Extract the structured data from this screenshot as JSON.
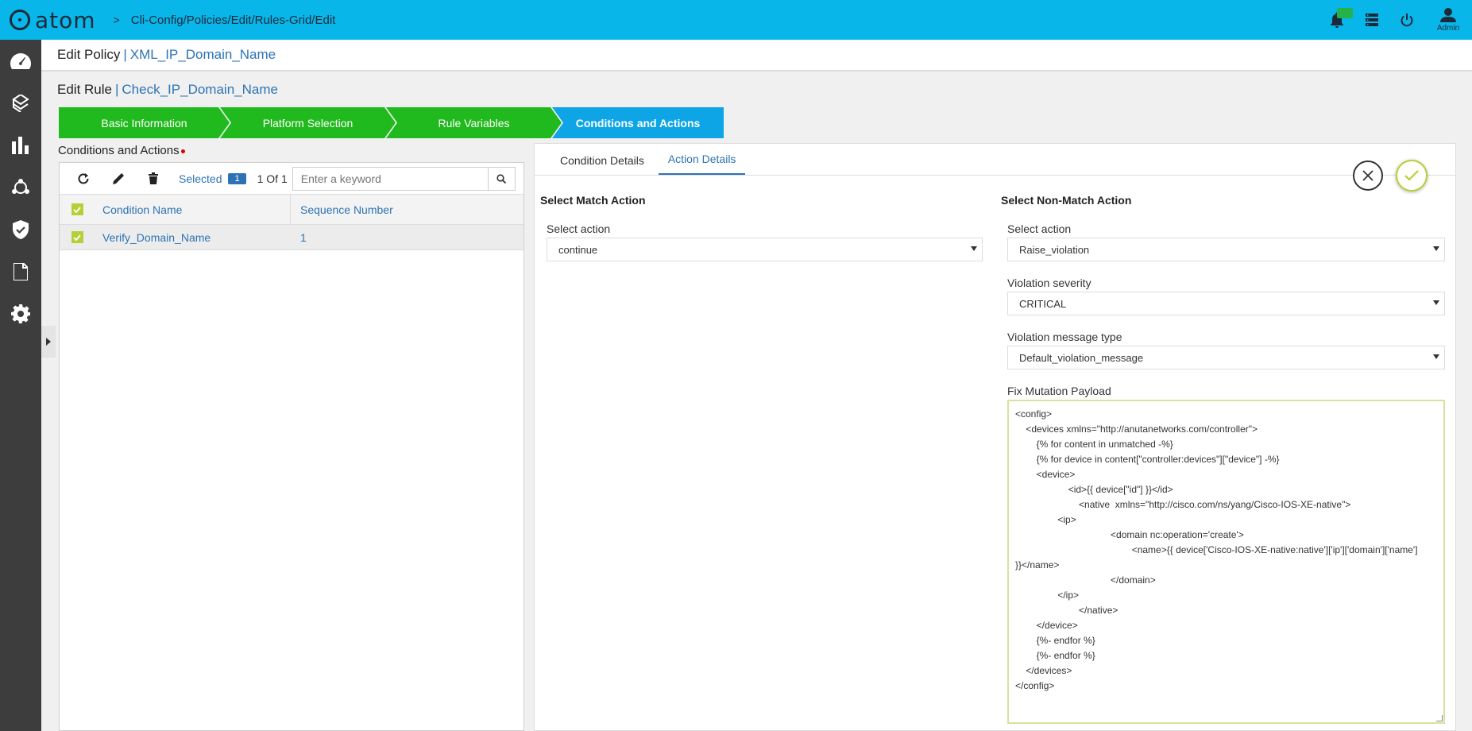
{
  "app": {
    "logo_text": "atom"
  },
  "breadcrumb": {
    "separator": ">",
    "path": "Cli-Config/Policies/Edit/Rules-Grid/Edit"
  },
  "top_icons": {
    "admin_label": "Admin"
  },
  "policy": {
    "label": "Edit Policy",
    "separator": "|",
    "name": "XML_IP_Domain_Name"
  },
  "rule": {
    "label": "Edit Rule",
    "separator": "|",
    "name": "Check_IP_Domain_Name"
  },
  "steps": [
    {
      "label": "Basic Information"
    },
    {
      "label": "Platform Selection"
    },
    {
      "label": "Rule Variables"
    },
    {
      "label": "Conditions and Actions"
    }
  ],
  "conditions": {
    "title": "Conditions and Actions",
    "selected_label": "Selected",
    "selected_count": "1",
    "page_info": "1 Of 1",
    "search_placeholder": "Enter a keyword",
    "columns": [
      "Condition Name",
      "Sequence Number"
    ],
    "rows": [
      {
        "name": "Verify_Domain_Name",
        "sequence": "1"
      }
    ]
  },
  "tabs": [
    {
      "label": "Condition Details"
    },
    {
      "label": "Action Details"
    }
  ],
  "match": {
    "title": "Select Match Action",
    "action_label": "Select action",
    "action_value": "continue"
  },
  "nonmatch": {
    "title": "Select Non-Match Action",
    "action_label": "Select action",
    "action_value": "Raise_violation",
    "severity_label": "Violation severity",
    "severity_value": "CRITICAL",
    "message_type_label": "Violation message type",
    "message_type_value": "Default_violation_message",
    "payload_label": "Fix Mutation Payload",
    "payload": "<config>\n    <devices xmlns=\"http://anutanetworks.com/controller\">\n        {% for content in unmatched -%}\n        {% for device in content[\"controller:devices\"][\"device\"] -%}\n        <device>\n                    <id>{{ device[\"id\"] }}</id>\n                        <native  xmlns=\"http://cisco.com/ns/yang/Cisco-IOS-XE-native\">\n                <ip>\n                                    <domain nc:operation='create'>\n                                            <name>{{ device['Cisco-IOS-XE-native:native']['ip']['domain']['name']\n}}</name>\n                                    </domain>\n                </ip>\n                        </native>\n        </device>\n        {%- endfor %}\n        {%- endfor %}\n    </devices>\n</config>"
  },
  "colors": {
    "topbar": "#09b6ea",
    "step_done": "#21ba1e",
    "step_active": "#0ea5e6",
    "link": "#2d73b4",
    "sidebar": "#3d3d3d",
    "checkbox": "#b3d137"
  }
}
